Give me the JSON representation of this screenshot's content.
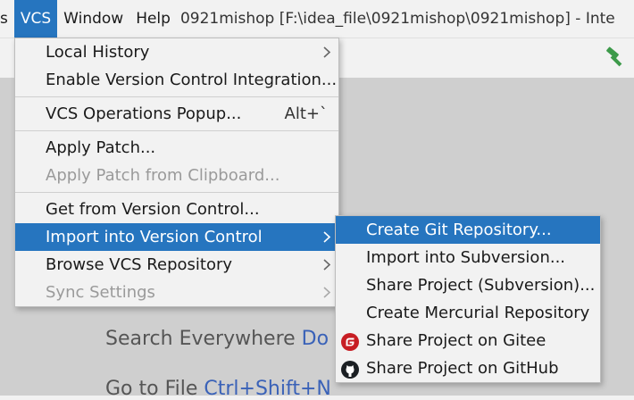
{
  "menubar": {
    "partial_item": "s",
    "vcs": "VCS",
    "window": "Window",
    "help": "Help",
    "title": "0921mishop [F:\\idea_file\\0921mishop\\0921mishop] - Inte"
  },
  "editor_hints": {
    "search_label": "Search Everywhere ",
    "search_shortcut": "Do",
    "goto_label": "Go to File ",
    "goto_shortcut": "Ctrl+Shift+N"
  },
  "vcs_menu": {
    "local_history": "Local History",
    "enable_vci": "Enable Version Control Integration...",
    "ops_popup": "VCS Operations Popup...",
    "ops_popup_shortcut": "Alt+`",
    "apply_patch": "Apply Patch...",
    "apply_patch_clipboard": "Apply Patch from Clipboard...",
    "get_from_vc": "Get from Version Control...",
    "import_into_vc": "Import into Version Control",
    "browse_repo": "Browse VCS Repository",
    "sync_settings": "Sync Settings"
  },
  "import_submenu": {
    "create_git": "Create Git Repository...",
    "import_svn": "Import into Subversion...",
    "share_svn": "Share Project (Subversion)...",
    "create_hg": "Create Mercurial Repository",
    "share_gitee": "Share Project on Gitee",
    "share_github": "Share Project on GitHub"
  },
  "colors": {
    "selection": "#2675bf",
    "gitee": "#c71d23",
    "hammer": "#3d9a4a"
  }
}
